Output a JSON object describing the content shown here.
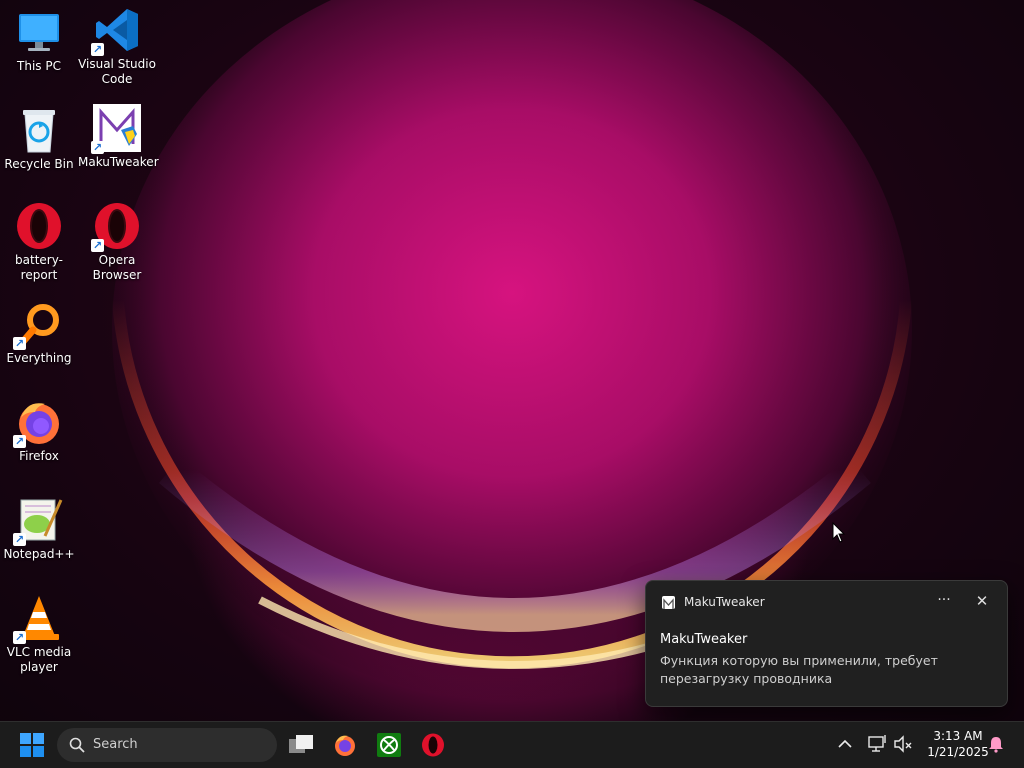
{
  "desktop": {
    "icons": [
      {
        "label": "This PC",
        "icon": "monitor-icon"
      },
      {
        "label": "Visual Studio Code",
        "icon": "vscode-icon"
      },
      {
        "label": "Recycle Bin",
        "icon": "recycle-bin-icon"
      },
      {
        "label": "MakuTweaker",
        "icon": "makutweaker-icon"
      },
      {
        "label": "battery-report",
        "icon": "opera-icon"
      },
      {
        "label": "Opera Browser",
        "icon": "opera-icon"
      },
      {
        "label": "Everything",
        "icon": "magnifier-icon"
      },
      {
        "label": "Firefox",
        "icon": "firefox-icon"
      },
      {
        "label": "Notepad++",
        "icon": "notepad-plus-plus-icon"
      },
      {
        "label": "VLC media player",
        "icon": "vlc-cone-icon"
      }
    ]
  },
  "notification": {
    "app_name": "MakuTweaker",
    "more_glyph": "···",
    "close_glyph": "✕",
    "title": "MakuTweaker",
    "body": "Функция которую вы применили, требует перезагрузку проводника"
  },
  "taskbar": {
    "search_label": "Search",
    "pinned": [
      "task-view-icon",
      "firefox-icon",
      "xbox-icon",
      "opera-icon"
    ],
    "tray": {
      "chevron": "^",
      "time": "3:13 AM",
      "date": "1/21/2025"
    }
  },
  "colors": {
    "accent": "#0a84ff",
    "taskbar": "#1c1c1c",
    "toast_bg": "#202020",
    "opera_red": "#e0112b"
  }
}
